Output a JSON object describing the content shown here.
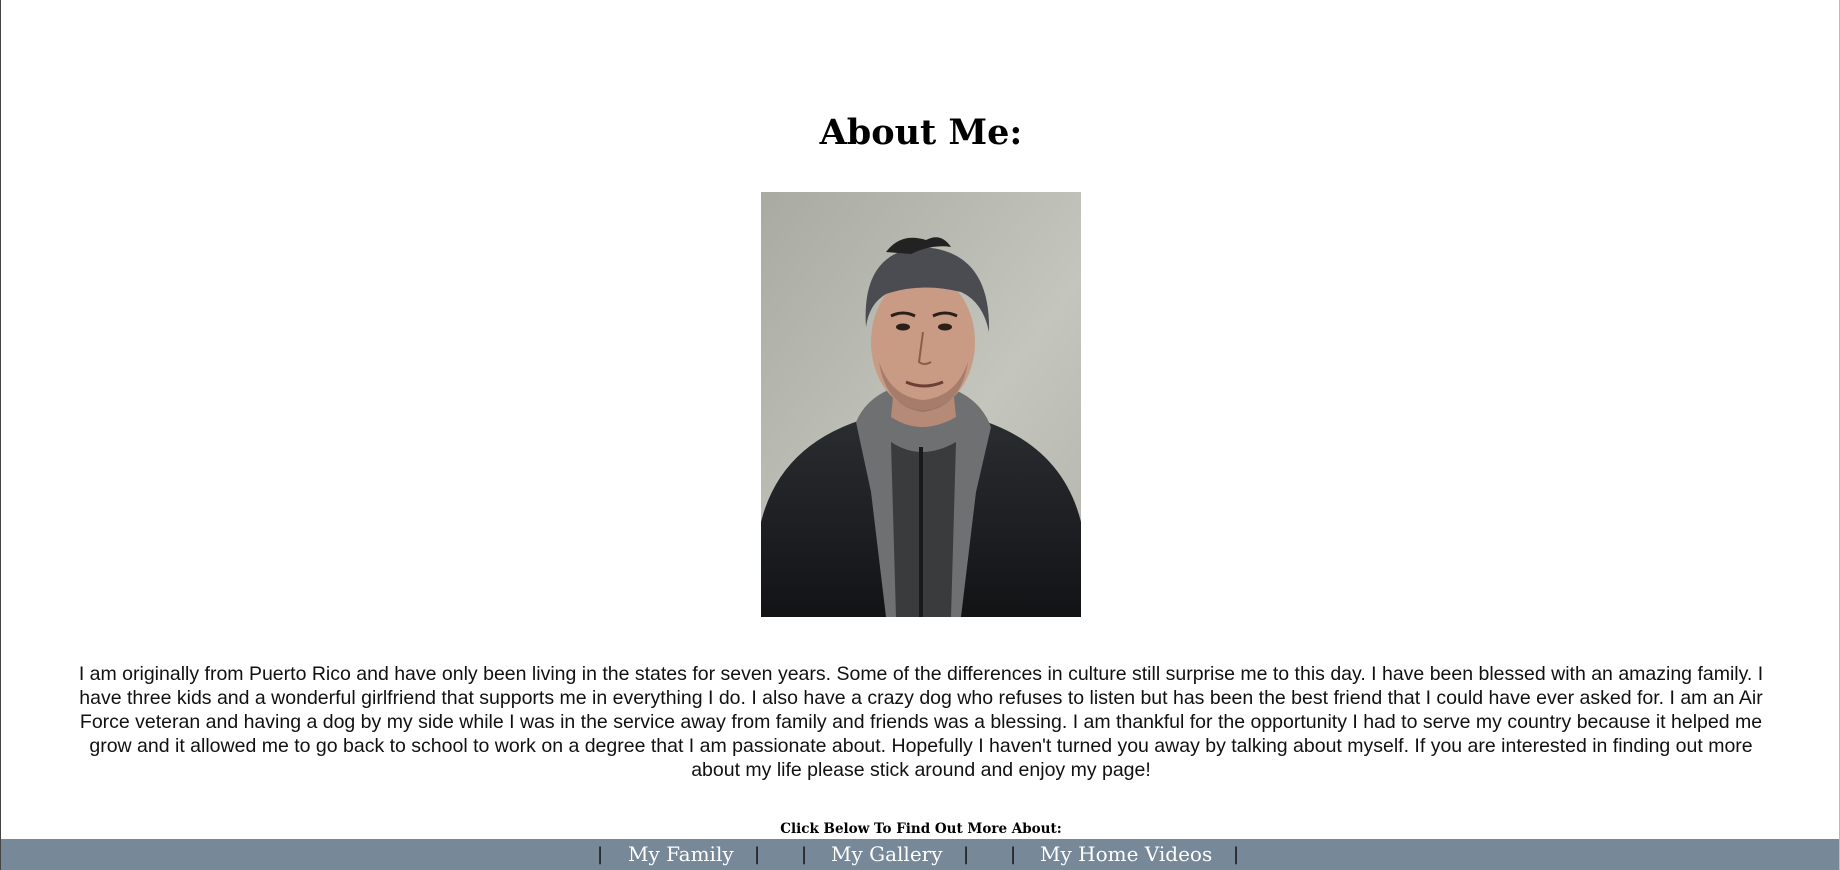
{
  "page": {
    "title": "About Me:",
    "bio": "I am originally from Puerto Rico and have only been living in the states for seven years. Some of the differences in culture still surprise me to this day. I have been blessed with an amazing family. I have three kids and a wonderful girlfriend that supports me in everything I do. I also have a crazy dog who refuses to listen but has been the best friend that I could have ever asked for. I am an Air Force veteran and having a dog by my side while I was in the service away from family and friends was a blessing. I am thankful for the opportunity I had to serve my country because it helped me grow and it allowed me to go back to school to work on a degree that I am passionate about. Hopefully I haven't turned you away by talking about myself. If you are interested in finding out more about my life please stick around and enjoy my page!",
    "nav_caption": "Click Below To Find Out More About:"
  },
  "nav": {
    "separator": "|",
    "links": [
      {
        "label": "My Family"
      },
      {
        "label": "My Gallery"
      },
      {
        "label": "My Home Videos"
      }
    ]
  },
  "colors": {
    "navbar_bg": "#778899",
    "nav_text": "#ffffff",
    "page_bg": "#ffffff"
  }
}
